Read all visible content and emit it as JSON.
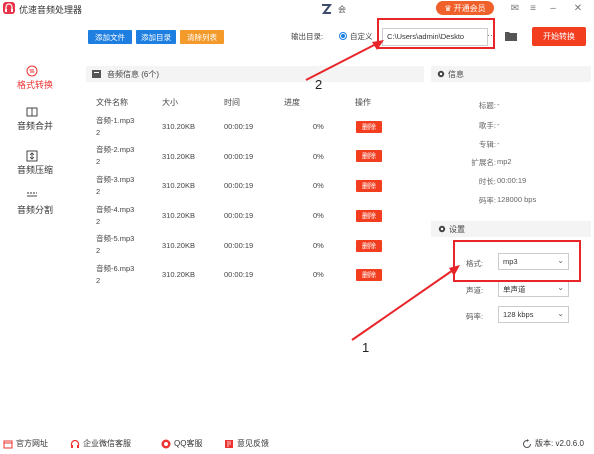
{
  "app": {
    "title": "优速音频处理器",
    "center_text": "会",
    "vip_label": "开通会员"
  },
  "toolbar": {
    "add_file": "添加文件",
    "add_folder": "添加目录",
    "clear_list": "清除列表",
    "output_label": "输出目录:",
    "custom_label": "自定义",
    "output_path": "C:\\Users\\admin\\Deskto",
    "more": "···",
    "start_button": "开始转换"
  },
  "sidebar": {
    "items": [
      {
        "label": "格式转换",
        "icon": "format-convert-icon",
        "active": true
      },
      {
        "label": "音频合并",
        "icon": "audio-merge-icon",
        "active": false
      },
      {
        "label": "音频压缩",
        "icon": "audio-compress-icon",
        "active": false
      },
      {
        "label": "音频分割",
        "icon": "audio-split-icon",
        "active": false
      }
    ]
  },
  "file_panel": {
    "title": "音频信息 (6个)",
    "columns": [
      "文件名称",
      "大小",
      "时间",
      "进度",
      "操作"
    ],
    "delete_label": "删除",
    "rows": [
      {
        "name": "音频-1.mp3",
        "suffix": "2",
        "size": "310.20KB",
        "time": "00:00:19",
        "progress": "0%"
      },
      {
        "name": "音频-2.mp3",
        "suffix": "2",
        "size": "310.20KB",
        "time": "00:00:19",
        "progress": "0%"
      },
      {
        "name": "音频-3.mp3",
        "suffix": "2",
        "size": "310.20KB",
        "time": "00:00:19",
        "progress": "0%"
      },
      {
        "name": "音频-4.mp3",
        "suffix": "2",
        "size": "310.20KB",
        "time": "00:00:19",
        "progress": "0%"
      },
      {
        "name": "音频-5.mp3",
        "suffix": "2",
        "size": "310.20KB",
        "time": "00:00:19",
        "progress": "0%"
      },
      {
        "name": "音频-6.mp3",
        "suffix": "2",
        "size": "310.20KB",
        "time": "00:00:19",
        "progress": "0%"
      }
    ]
  },
  "info_panel": {
    "title": "信息",
    "fields": [
      {
        "label": "标题:",
        "value": "-"
      },
      {
        "label": "歌手:",
        "value": "-"
      },
      {
        "label": "专辑:",
        "value": "-"
      },
      {
        "label": "扩展名:",
        "value": "mp2"
      },
      {
        "label": "时长:",
        "value": "00:00:19"
      },
      {
        "label": "码率:",
        "value": "128000 bps"
      }
    ]
  },
  "settings": {
    "title": "设置",
    "format_label": "格式:",
    "format_value": "mp3",
    "channel_label": "声道:",
    "channel_value": "单声道",
    "bitrate_label": "码率:",
    "bitrate_value": "128 kbps"
  },
  "annotations": {
    "marker_1": "1",
    "marker_2": "2",
    "color": "#e8262a"
  },
  "footer": {
    "website": "官方网址",
    "wechat": "企业微信客服",
    "qq": "QQ客服",
    "feedback": "意见反馈",
    "version": "版本: v2.0.6.0"
  },
  "colors": {
    "primary_blue": "#1e7fe0",
    "orange": "#f39a2b",
    "red": "#f23d1f",
    "vip": "#f0602a"
  }
}
